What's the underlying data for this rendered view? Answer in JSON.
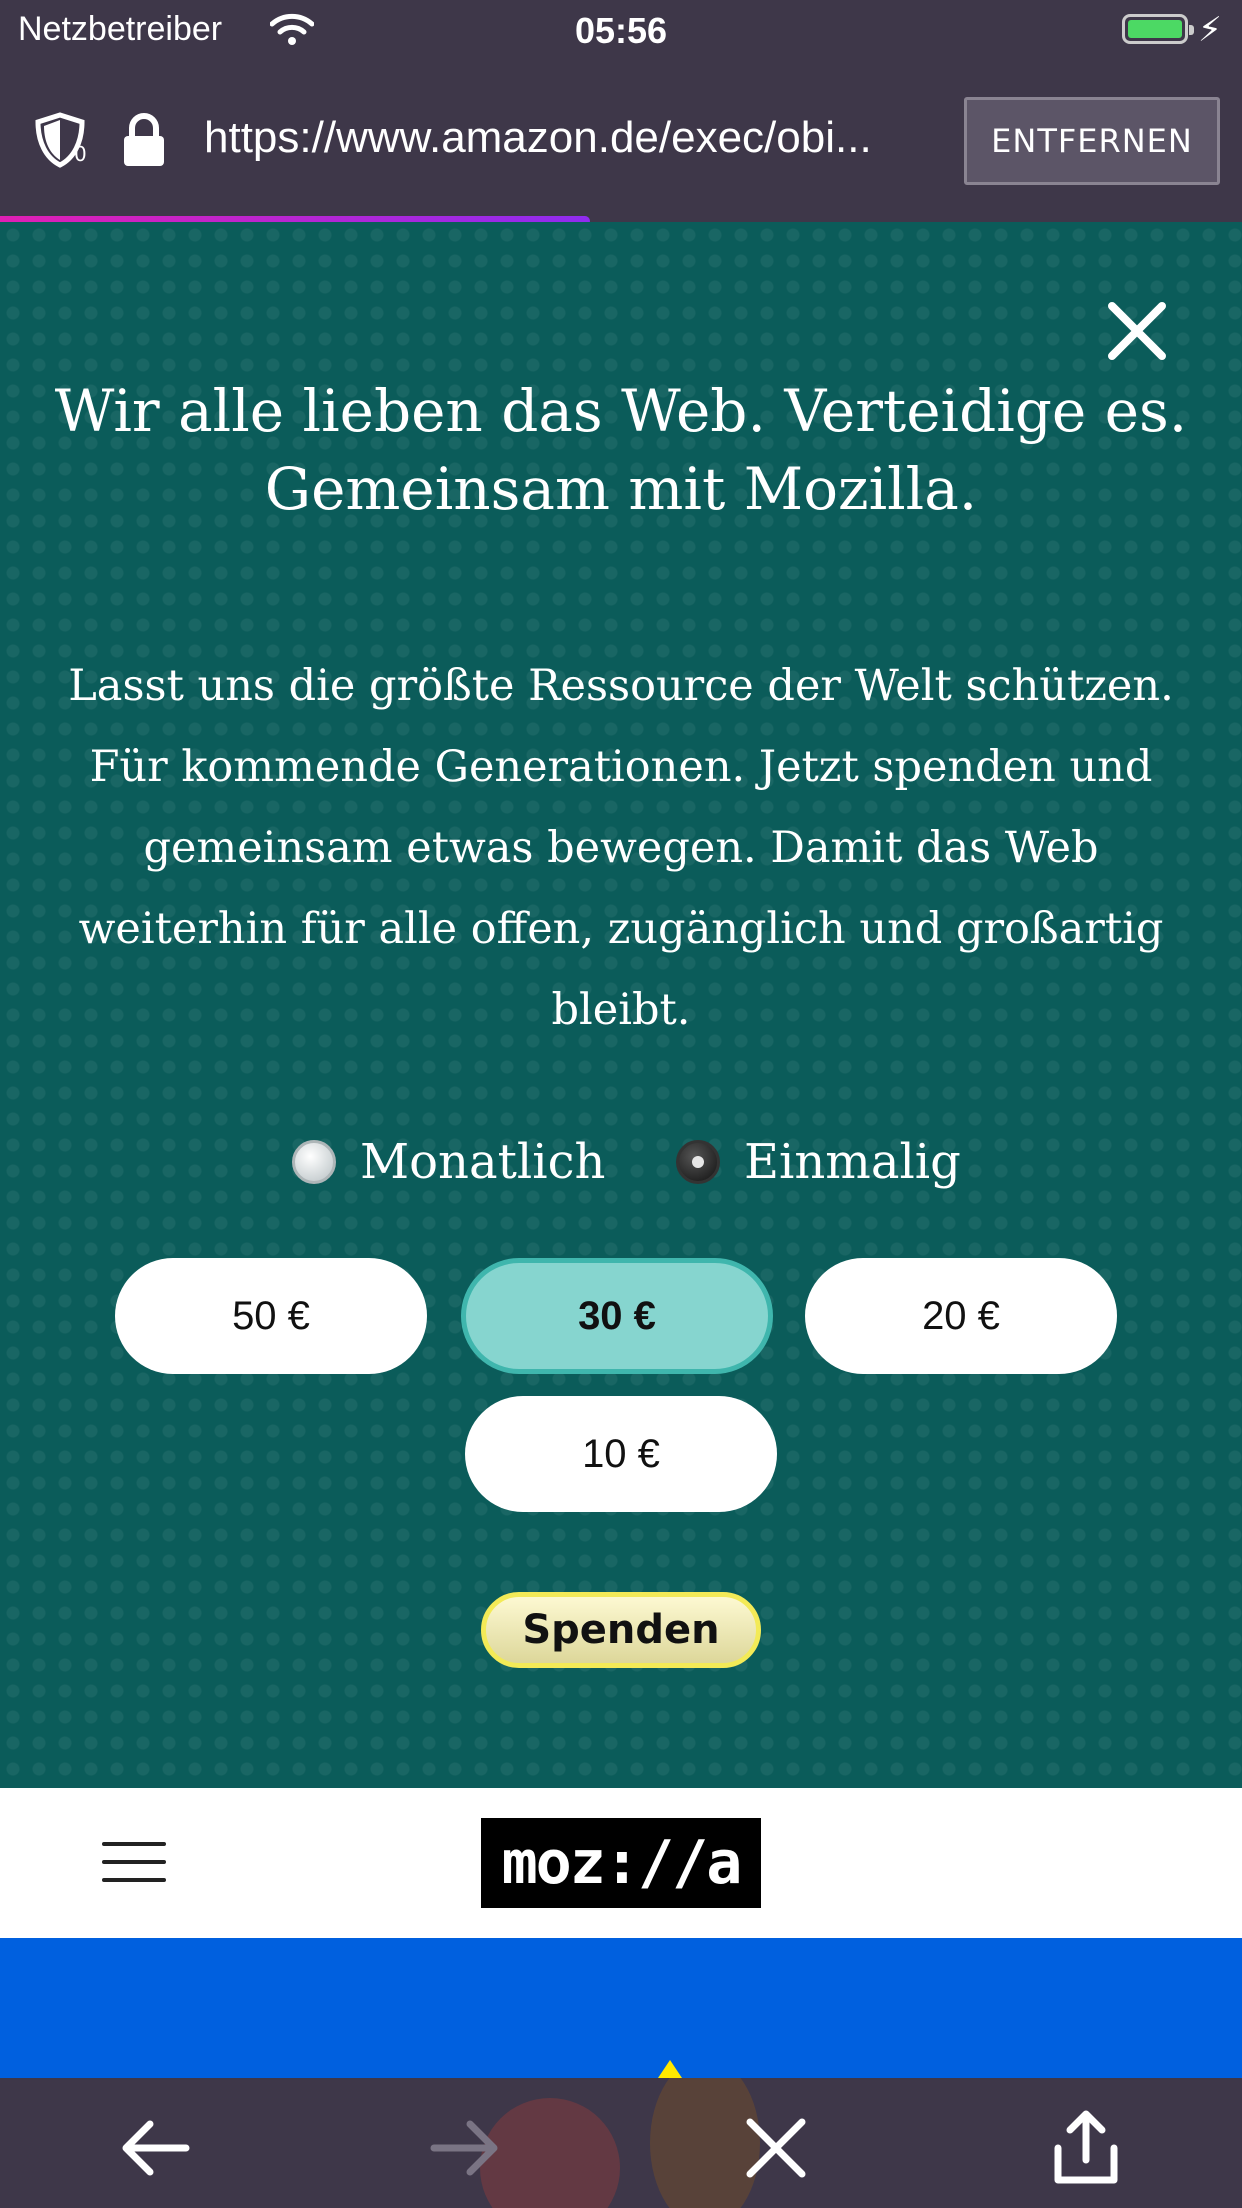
{
  "status_bar": {
    "carrier": "Netzbetreiber",
    "time": "05:56"
  },
  "url_bar": {
    "tracker_count": "0",
    "url": "https://www.amazon.de/exec/obi...",
    "remove_label": "ENTFERNEN",
    "load_progress": 0.475
  },
  "banner": {
    "headline": "Wir alle lieben das Web. Verteidige es. Gemeinsam mit Mozilla.",
    "body": "Lasst uns die größte Ressource der Welt schützen. Für kommende Generationen. Jetzt spenden und gemeinsam etwas bewegen. Damit das Web weiterhin für alle offen, zugänglich und großartig bleibt.",
    "frequency": {
      "options": [
        "Monatlich",
        "Einmalig"
      ],
      "selected": "Einmalig"
    },
    "amounts": [
      "50 €",
      "30 €",
      "20 €",
      "10 €"
    ],
    "selected_amount": "30 €",
    "donate_label": "Spenden"
  },
  "site_header": {
    "logo_text": "moz://a"
  },
  "colors": {
    "banner_bg": "#0b5c5a",
    "selected_amount": "#86d5cf",
    "toolbar_bg": "#3e3749",
    "progress": "#e01fb4"
  }
}
